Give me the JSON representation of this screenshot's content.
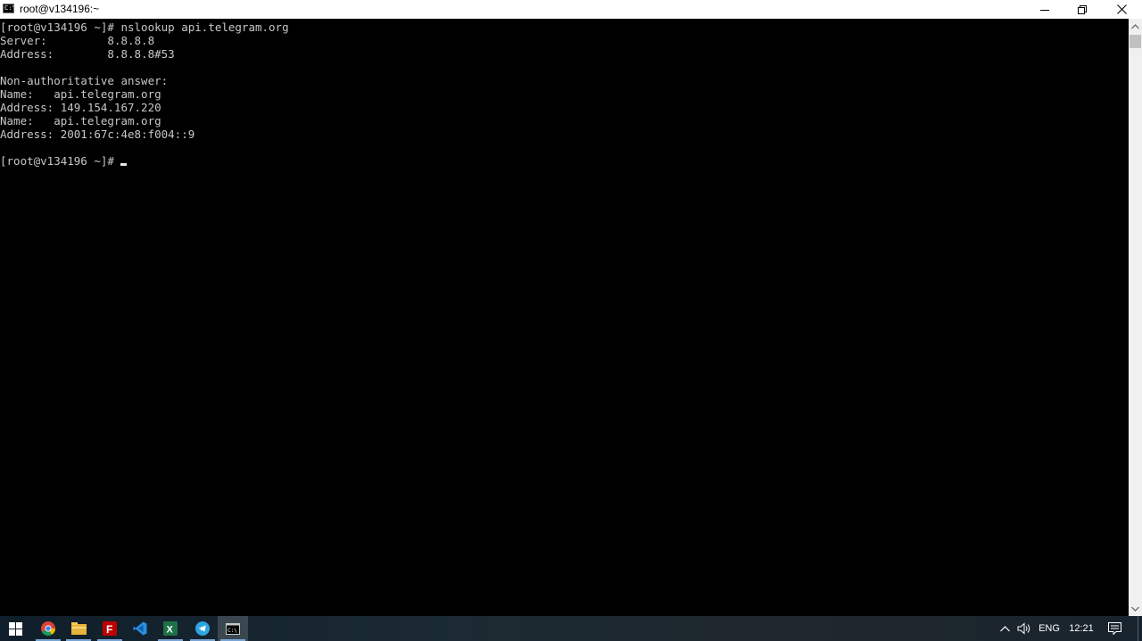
{
  "window": {
    "title": "root@v134196:~",
    "icon_label": "C:\\"
  },
  "terminal": {
    "lines": [
      "[root@v134196 ~]# nslookup api.telegram.org",
      "Server:         8.8.8.8",
      "Address:        8.8.8.8#53",
      "",
      "Non-authoritative answer:",
      "Name:   api.telegram.org",
      "Address: 149.154.167.220",
      "Name:   api.telegram.org",
      "Address: 2001:67c:4e8:f004::9",
      "",
      "[root@v134196 ~]# "
    ],
    "text_color": "#c7c7c7",
    "background": "#000000"
  },
  "taskbar": {
    "apps": [
      {
        "name": "chrome-icon"
      },
      {
        "name": "file-explorer-icon"
      },
      {
        "name": "filezilla-icon"
      },
      {
        "name": "vscode-icon"
      },
      {
        "name": "excel-icon"
      },
      {
        "name": "telegram-icon"
      },
      {
        "name": "command-prompt-icon"
      }
    ],
    "tray": {
      "language": "ENG",
      "clock": "12:21"
    }
  }
}
